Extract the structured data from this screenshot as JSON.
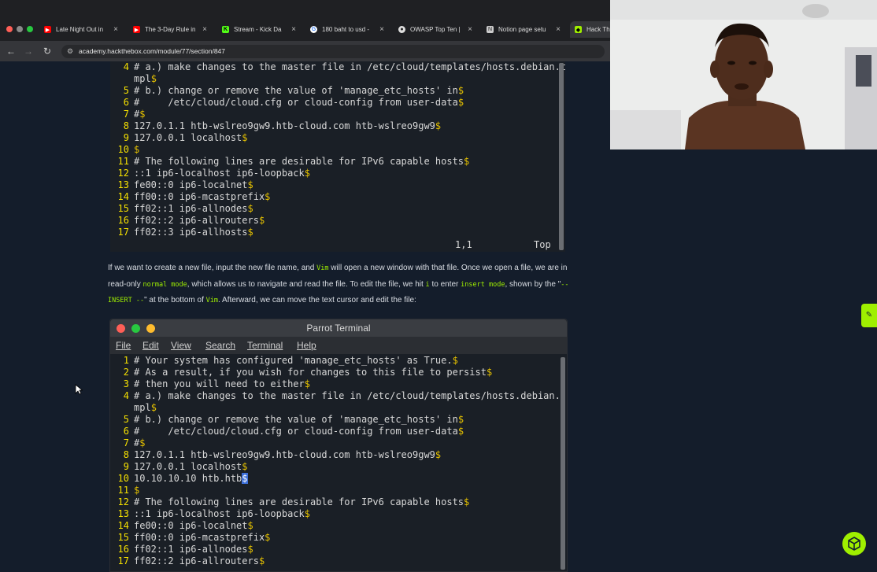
{
  "browser": {
    "tabs": [
      {
        "title": "Late Night Out in",
        "icon": "youtube-icon",
        "color": "#ff0000"
      },
      {
        "title": "The 3-Day Rule in",
        "icon": "youtube-icon",
        "color": "#ff0000"
      },
      {
        "title": "Stream - Kick Da",
        "icon": "kick-icon",
        "color": "#53fc18"
      },
      {
        "title": "180 baht to usd -",
        "icon": "google-icon",
        "color": "#4285f4"
      },
      {
        "title": "OWASP Top Ten |",
        "icon": "owasp-icon",
        "color": "#cccccc"
      },
      {
        "title": "Notion page setu",
        "icon": "notion-icon",
        "color": "#cccccc"
      },
      {
        "title": "Hack Th",
        "icon": "htb-icon",
        "color": "#9fef00"
      }
    ],
    "url": "academy.hackthebox.com/module/77/section/847"
  },
  "top_terminal": {
    "lines": [
      {
        "n": "4",
        "text": "# a.) make changes to the master file in /etc/cloud/templates/hosts.debian.t"
      },
      {
        "n": "",
        "text": "mpl",
        "eol": "$"
      },
      {
        "n": "5",
        "text": "# b.) change or remove the value of 'manage_etc_hosts' in",
        "eol": "$"
      },
      {
        "n": "6",
        "text": "#     /etc/cloud/cloud.cfg or cloud-config from user-data",
        "eol": "$"
      },
      {
        "n": "7",
        "text": "#",
        "eol": "$"
      },
      {
        "n": "8",
        "text": "127.0.1.1 htb-wslreo9gw9.htb-cloud.com htb-wslreo9gw9",
        "eol": "$"
      },
      {
        "n": "9",
        "text": "127.0.0.1 localhost",
        "eol": "$"
      },
      {
        "n": "10",
        "text": "",
        "eol": "$"
      },
      {
        "n": "11",
        "text": "# The following lines are desirable for IPv6 capable hosts",
        "eol": "$"
      },
      {
        "n": "12",
        "text": "::1 ip6-localhost ip6-loopback",
        "eol": "$"
      },
      {
        "n": "13",
        "text": "fe00::0 ip6-localnet",
        "eol": "$"
      },
      {
        "n": "14",
        "text": "ff00::0 ip6-mcastprefix",
        "eol": "$"
      },
      {
        "n": "15",
        "text": "ff02::1 ip6-allnodes",
        "eol": "$"
      },
      {
        "n": "16",
        "text": "ff02::2 ip6-allrouters",
        "eol": "$"
      },
      {
        "n": "17",
        "text": "ff02::3 ip6-allhosts",
        "eol": "$"
      }
    ],
    "status_pos": "1,1",
    "status_scroll": "Top"
  },
  "prose": {
    "p1": "If we want to create a new file, input the new file name, and ",
    "vim1": "Vim",
    "p2": " will open a new window with that file. Once we open a file, we are in read-only ",
    "normal_mode": "normal mode",
    "p3": ", which allows us to navigate and read the file. To edit the file, we hit ",
    "key_i": "i",
    "p4": " to enter ",
    "insert_mode": "insert mode",
    "p5": ", shown by the \"",
    "insert_banner": "-- INSERT --",
    "p6": "\" at the bottom of ",
    "vim2": "Vim",
    "p7": ". Afterward, we can move the text cursor and edit the file:"
  },
  "parrot_terminal": {
    "title": "Parrot Terminal",
    "menu": [
      "File",
      "Edit",
      "View",
      "Search",
      "Terminal",
      "Help"
    ],
    "lines": [
      {
        "n": "1",
        "text": "# Your system has configured 'manage_etc_hosts' as True.",
        "eol": "$"
      },
      {
        "n": "2",
        "text": "# As a result, if you wish for changes to this file to persist",
        "eol": "$"
      },
      {
        "n": "3",
        "text": "# then you will need to either",
        "eol": "$"
      },
      {
        "n": "4",
        "text": "# a.) make changes to the master file in /etc/cloud/templates/hosts.debian.t"
      },
      {
        "n": "",
        "text": "mpl",
        "eol": "$"
      },
      {
        "n": "5",
        "text": "# b.) change or remove the value of 'manage_etc_hosts' in",
        "eol": "$"
      },
      {
        "n": "6",
        "text": "#     /etc/cloud/cloud.cfg or cloud-config from user-data",
        "eol": "$"
      },
      {
        "n": "7",
        "text": "#",
        "eol": "$"
      },
      {
        "n": "8",
        "text": "127.0.1.1 htb-wslreo9gw9.htb-cloud.com htb-wslreo9gw9",
        "eol": "$"
      },
      {
        "n": "9",
        "text": "127.0.0.1 localhost",
        "eol": "$"
      },
      {
        "n": "10",
        "text": "10.10.10.10 htb.htb",
        "eol": "$",
        "cursor": true
      },
      {
        "n": "11",
        "text": "",
        "eol": "$"
      },
      {
        "n": "12",
        "text": "# The following lines are desirable for IPv6 capable hosts",
        "eol": "$"
      },
      {
        "n": "13",
        "text": "::1 ip6-localhost ip6-loopback",
        "eol": "$"
      },
      {
        "n": "14",
        "text": "fe00::0 ip6-localnet",
        "eol": "$"
      },
      {
        "n": "15",
        "text": "ff00::0 ip6-mcastprefix",
        "eol": "$"
      },
      {
        "n": "16",
        "text": "ff02::1 ip6-allnodes",
        "eol": "$"
      },
      {
        "n": "17",
        "text": "ff02::2 ip6-allrouters",
        "eol": "$"
      }
    ]
  },
  "colors": {
    "page_bg": "#141d2b",
    "accent": "#9fef00",
    "vim_line_number": "#f5e000"
  }
}
